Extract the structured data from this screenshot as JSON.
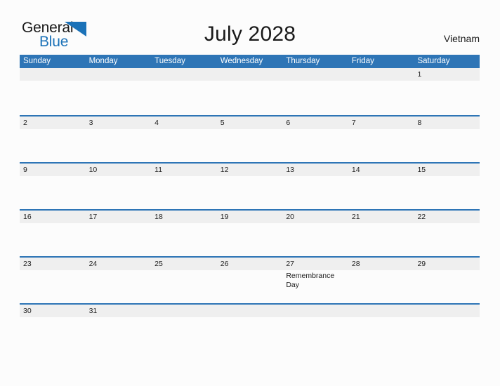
{
  "brand": {
    "word_one": "General",
    "word_two": "Blue",
    "mark_icon": "triangle-mark-icon",
    "colors": {
      "text_dark": "#1a1a1a",
      "blue": "#1b72b8"
    }
  },
  "header": {
    "title": "July 2028",
    "region": "Vietnam"
  },
  "theme": {
    "header_blue": "#2e75b6",
    "row_gray": "#efefef",
    "page_background": "#fcfcfc"
  },
  "calendar": {
    "weekdays": [
      "Sunday",
      "Monday",
      "Tuesday",
      "Wednesday",
      "Thursday",
      "Friday",
      "Saturday"
    ],
    "weeks": [
      {
        "days": [
          {
            "date": "",
            "events": []
          },
          {
            "date": "",
            "events": []
          },
          {
            "date": "",
            "events": []
          },
          {
            "date": "",
            "events": []
          },
          {
            "date": "",
            "events": []
          },
          {
            "date": "",
            "events": []
          },
          {
            "date": "1",
            "events": []
          }
        ]
      },
      {
        "days": [
          {
            "date": "2",
            "events": []
          },
          {
            "date": "3",
            "events": []
          },
          {
            "date": "4",
            "events": []
          },
          {
            "date": "5",
            "events": []
          },
          {
            "date": "6",
            "events": []
          },
          {
            "date": "7",
            "events": []
          },
          {
            "date": "8",
            "events": []
          }
        ]
      },
      {
        "days": [
          {
            "date": "9",
            "events": []
          },
          {
            "date": "10",
            "events": []
          },
          {
            "date": "11",
            "events": []
          },
          {
            "date": "12",
            "events": []
          },
          {
            "date": "13",
            "events": []
          },
          {
            "date": "14",
            "events": []
          },
          {
            "date": "15",
            "events": []
          }
        ]
      },
      {
        "days": [
          {
            "date": "16",
            "events": []
          },
          {
            "date": "17",
            "events": []
          },
          {
            "date": "18",
            "events": []
          },
          {
            "date": "19",
            "events": []
          },
          {
            "date": "20",
            "events": []
          },
          {
            "date": "21",
            "events": []
          },
          {
            "date": "22",
            "events": []
          }
        ]
      },
      {
        "days": [
          {
            "date": "23",
            "events": []
          },
          {
            "date": "24",
            "events": []
          },
          {
            "date": "25",
            "events": []
          },
          {
            "date": "26",
            "events": []
          },
          {
            "date": "27",
            "events": [
              "Remembrance Day"
            ]
          },
          {
            "date": "28",
            "events": []
          },
          {
            "date": "29",
            "events": []
          }
        ]
      },
      {
        "days": [
          {
            "date": "30",
            "events": []
          },
          {
            "date": "31",
            "events": []
          },
          {
            "date": "",
            "events": []
          },
          {
            "date": "",
            "events": []
          },
          {
            "date": "",
            "events": []
          },
          {
            "date": "",
            "events": []
          },
          {
            "date": "",
            "events": []
          }
        ]
      }
    ]
  }
}
